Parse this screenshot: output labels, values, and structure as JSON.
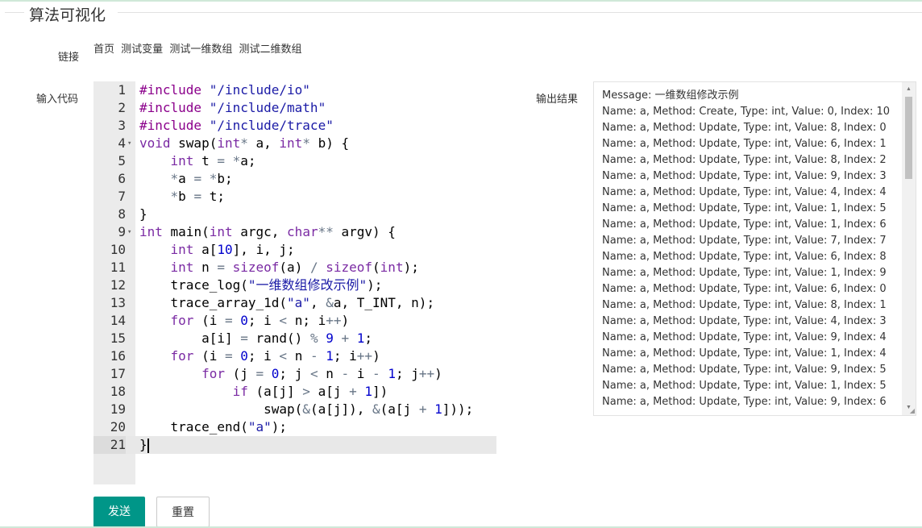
{
  "page": {
    "legend": "算法可视化",
    "links_label": "链接",
    "links": [
      "首页",
      "测试变量",
      "测试一维数组",
      "测试二维数组"
    ],
    "code_label": "输入代码",
    "output_label": "输出结果",
    "submit_button": "发送",
    "reset_button": "重置"
  },
  "code": {
    "active_line": 21,
    "lines": [
      "#include \"/include/io\"",
      "#include \"/include/math\"",
      "#include \"/include/trace\"",
      "void swap(int* a, int* b) {",
      "    int t = *a;",
      "    *a = *b;",
      "    *b = t;",
      "}",
      "int main(int argc, char** argv) {",
      "    int a[10], i, j;",
      "    int n = sizeof(a) / sizeof(int);",
      "    trace_log(\"一维数组修改示例\");",
      "    trace_array_1d(\"a\", &a, T_INT, n);",
      "    for (i = 0; i < n; i++)",
      "        a[i] = rand() % 9 + 1;",
      "    for (i = 0; i < n - 1; i++)",
      "        for (j = 0; j < n - i - 1; j++)",
      "            if (a[j] > a[j + 1])",
      "                swap(&(a[j]), &(a[j + 1]));",
      "    trace_end(\"a\");",
      "}"
    ]
  },
  "output": {
    "lines": [
      "Message: 一维数组修改示例",
      "Name: a,  Method: Create, Type: int, Value: 0, Index: 10",
      "Name: a,  Method: Update, Type: int, Value: 8, Index: 0",
      "Name: a,  Method: Update, Type: int, Value: 6, Index: 1",
      "Name: a,  Method: Update, Type: int, Value: 8, Index: 2",
      "Name: a,  Method: Update, Type: int, Value: 9, Index: 3",
      "Name: a,  Method: Update, Type: int, Value: 4, Index: 4",
      "Name: a,  Method: Update, Type: int, Value: 1, Index: 5",
      "Name: a,  Method: Update, Type: int, Value: 1, Index: 6",
      "Name: a,  Method: Update, Type: int, Value: 7, Index: 7",
      "Name: a,  Method: Update, Type: int, Value: 6, Index: 8",
      "Name: a,  Method: Update, Type: int, Value: 1, Index: 9",
      "Name: a,  Method: Update, Type: int, Value: 6, Index: 0",
      "Name: a,  Method: Update, Type: int, Value: 8, Index: 1",
      "Name: a,  Method: Update, Type: int, Value: 4, Index: 3",
      "Name: a,  Method: Update, Type: int, Value: 9, Index: 4",
      "Name: a,  Method: Update, Type: int, Value: 1, Index: 4",
      "Name: a,  Method: Update, Type: int, Value: 9, Index: 5",
      "Name: a,  Method: Update, Type: int, Value: 1, Index: 5",
      "Name: a,  Method: Update, Type: int, Value: 9, Index: 6"
    ]
  },
  "colors": {
    "primary_button": "#009688",
    "gutter": "#ebebeb",
    "active_line": "#e8e8e8"
  }
}
